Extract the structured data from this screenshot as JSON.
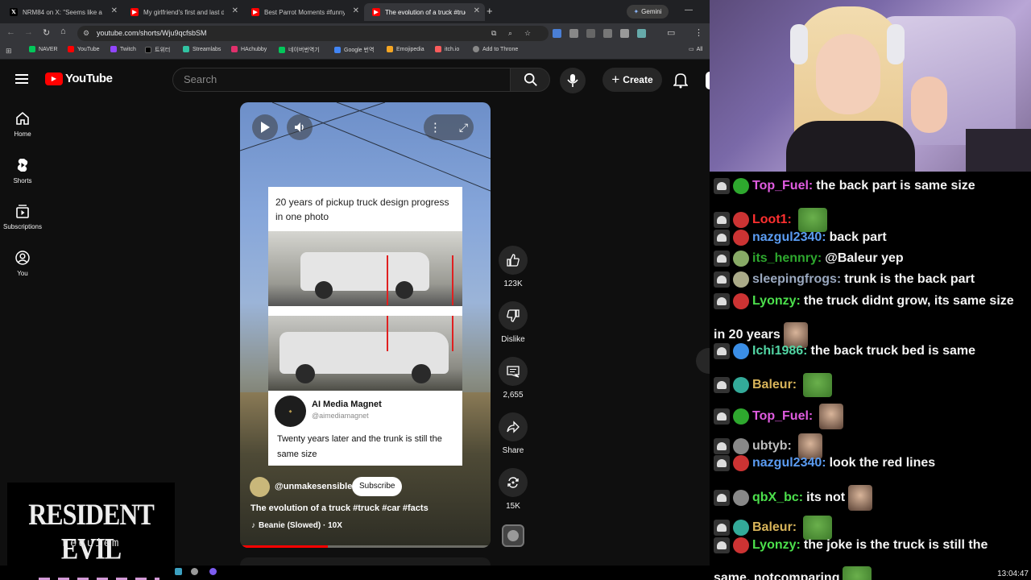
{
  "browser": {
    "tabs": [
      {
        "title": "NRM84 on X: \"Seems like a wa",
        "icon": "x-icon",
        "color": "#000000"
      },
      {
        "title": "My girlfriend's first and last dri",
        "icon": "youtube-icon",
        "color": "#ff0000"
      },
      {
        "title": "Best Parrot Moments #funnysh",
        "icon": "youtube-icon",
        "color": "#ff0000"
      },
      {
        "title": "The evolution of a truck #truck",
        "icon": "youtube-icon",
        "color": "#ff0000"
      }
    ],
    "gemini_label": "Gemini",
    "url": "youtube.com/shorts/Wju9qcfsbSM",
    "bookmarks": [
      {
        "label": "NAVER",
        "color": "#03c75a"
      },
      {
        "label": "YouTube",
        "color": "#ff0000"
      },
      {
        "label": "Twitch",
        "color": "#9146ff"
      },
      {
        "label": "트위터",
        "color": "#000000"
      },
      {
        "label": "Streamlabs",
        "color": "#31c3a2"
      },
      {
        "label": "HAchubby",
        "color": "#e1306c"
      },
      {
        "label": "네이버번역기",
        "color": "#03c75a"
      },
      {
        "label": "Google 번역",
        "color": "#4285f4"
      },
      {
        "label": "Emojipedia",
        "color": "#f5a623"
      },
      {
        "label": "itch.io",
        "color": "#fa5c5c"
      },
      {
        "label": "Add to Throne",
        "color": "#888888"
      }
    ],
    "all_bookmarks": "All"
  },
  "youtube": {
    "logo": "YouTube",
    "search_placeholder": "Search",
    "create_label": "Create",
    "sidebar": [
      {
        "label": "Home",
        "icon": "home-icon"
      },
      {
        "label": "Shorts",
        "icon": "shorts-icon"
      },
      {
        "label": "Subscriptions",
        "icon": "subscriptions-icon"
      },
      {
        "label": "You",
        "icon": "you-icon"
      }
    ],
    "short": {
      "card_text": "20 years of pickup truck design progress in one photo",
      "author_name": "AI Media Magnet",
      "author_handle": "@aimediamagnet",
      "caption": "Twenty years later and the trunk is still the same size",
      "channel": "@unmakesensible",
      "subscribe_label": "Subscribe",
      "title_prefix": "The evolution of a truck ",
      "hashtags": "#truck #car #facts",
      "audio": "Beanie (Slowed) · 10X",
      "progress": 0.35
    },
    "actions": [
      {
        "icon": "like-icon",
        "label": "123K"
      },
      {
        "icon": "dislike-icon",
        "label": "Dislike"
      },
      {
        "icon": "comment-icon",
        "label": "2,655"
      },
      {
        "icon": "share-icon",
        "label": "Share"
      },
      {
        "icon": "remix-icon",
        "label": "15K"
      }
    ]
  },
  "overlay": {
    "game_title": "RESIDENT EVIL",
    "game_subtitle": "requiem",
    "clock": "13:04:47"
  },
  "chat": [
    {
      "user": "Top_Fuel:",
      "user_color": "#e05ce0",
      "text": "the back part is same size",
      "emote": ""
    },
    {
      "user": "Loot1:",
      "user_color": "#ff3030",
      "text": "",
      "emote": "pepe"
    },
    {
      "user": "nazgul2340:",
      "user_color": "#5b9cf2",
      "text": "back part",
      "emote": ""
    },
    {
      "user": "its_hennry:",
      "user_color": "#2ea82e",
      "text": "@Baleur yep",
      "emote": ""
    },
    {
      "user": "sleepingfrogs:",
      "user_color": "#9aa8bf",
      "text": "trunk is the back part",
      "emote": ""
    },
    {
      "user": "Lyonzy:",
      "user_color": "#4ce04c",
      "text": "the truck didnt grow, its same size",
      "emote": ""
    },
    {
      "user": "",
      "user_color": "#ffffff",
      "text": "in 20 years",
      "emote": "face"
    },
    {
      "user": "Ichi1986:",
      "user_color": "#52d6a4",
      "text": "the back truck bed is same",
      "emote": ""
    },
    {
      "user": "Baleur:",
      "user_color": "#d8b45a",
      "text": "",
      "emote": "pepe"
    },
    {
      "user": "Top_Fuel:",
      "user_color": "#e05ce0",
      "text": "",
      "emote": "face"
    },
    {
      "user": "ubtyb:",
      "user_color": "#bdbdbd",
      "text": "",
      "emote": "face"
    },
    {
      "user": "nazgul2340:",
      "user_color": "#5b9cf2",
      "text": "look the red lines",
      "emote": ""
    },
    {
      "user": "qbX_bc:",
      "user_color": "#4ce04c",
      "text": "its not",
      "emote": "face"
    },
    {
      "user": "Baleur:",
      "user_color": "#d8b45a",
      "text": "",
      "emote": "pepe"
    },
    {
      "user": "Lyonzy:",
      "user_color": "#4ce04c",
      "text": "the joke is the truck is still the",
      "emote": ""
    },
    {
      "user": "",
      "user_color": "#ffffff",
      "text": "same, notcomparing",
      "emote": "pepe"
    }
  ]
}
